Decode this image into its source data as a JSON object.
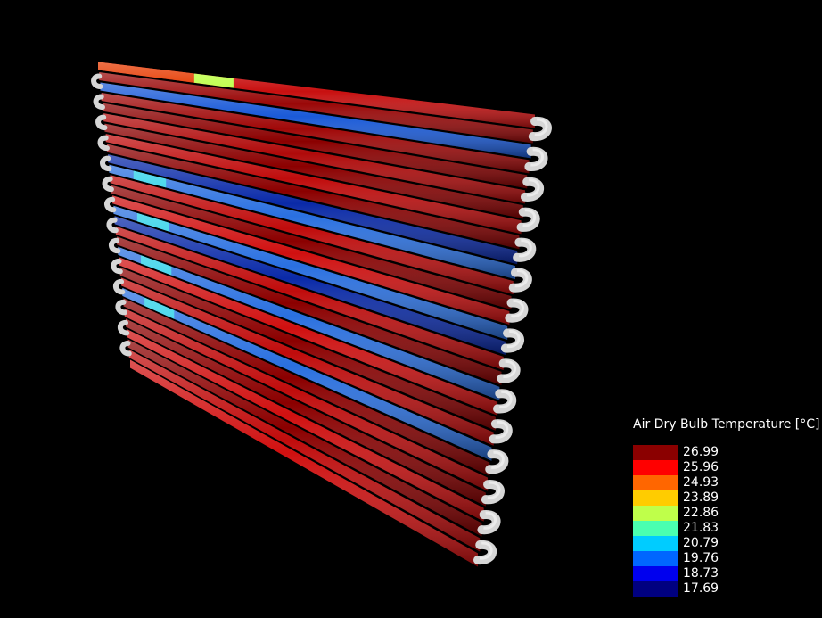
{
  "scene": {
    "background": "#000000",
    "bend_color": "#d6d6d6",
    "tube_rows_description_free": true
  },
  "legend": {
    "title": "Air Dry Bulb Temperature [°C]",
    "entries": [
      {
        "label": "26.99",
        "color": "#8b0000"
      },
      {
        "label": "25.96",
        "color": "#ff0000"
      },
      {
        "label": "24.93",
        "color": "#ff6600"
      },
      {
        "label": "23.89",
        "color": "#ffcc00"
      },
      {
        "label": "22.86",
        "color": "#bfff4a"
      },
      {
        "label": "21.83",
        "color": "#4affb0"
      },
      {
        "label": "20.79",
        "color": "#00ccff"
      },
      {
        "label": "19.76",
        "color": "#0066ff"
      },
      {
        "label": "18.73",
        "color": "#0000ee"
      },
      {
        "label": "17.69",
        "color": "#000080"
      }
    ]
  },
  "tubes": [
    {
      "color": "#c81010",
      "mid": "#e63a00",
      "accent": "#bfff4a"
    },
    {
      "color": "#9a0808"
    },
    {
      "color": "#1a5ad8"
    },
    {
      "color": "#a00808"
    },
    {
      "color": "#8b0000"
    },
    {
      "color": "#b00a0a"
    },
    {
      "color": "#8b0000"
    },
    {
      "color": "#c00c0c"
    },
    {
      "color": "#8b0000"
    },
    {
      "color": "#0a2aa8"
    },
    {
      "color": "#2a70e0",
      "accent": "#2ad0e8"
    },
    {
      "color": "#c00c0c"
    },
    {
      "color": "#8b0000"
    },
    {
      "color": "#d01010"
    },
    {
      "color": "#2a70e0",
      "accent": "#2ad0e8"
    },
    {
      "color": "#0a2aa8"
    },
    {
      "color": "#c00c0c"
    },
    {
      "color": "#8b0000"
    },
    {
      "color": "#2a70e0",
      "accent": "#2ad0e8"
    },
    {
      "color": "#d01010"
    },
    {
      "color": "#8b0000"
    },
    {
      "color": "#c00c0c"
    },
    {
      "color": "#2a70e0",
      "accent": "#2ad0e8"
    },
    {
      "color": "#8b0000"
    },
    {
      "color": "#c00c0c"
    },
    {
      "color": "#8b0000"
    },
    {
      "color": "#d01010"
    },
    {
      "color": "#8b0000"
    },
    {
      "color": "#c00c0c"
    },
    {
      "color": "#d01010"
    }
  ]
}
